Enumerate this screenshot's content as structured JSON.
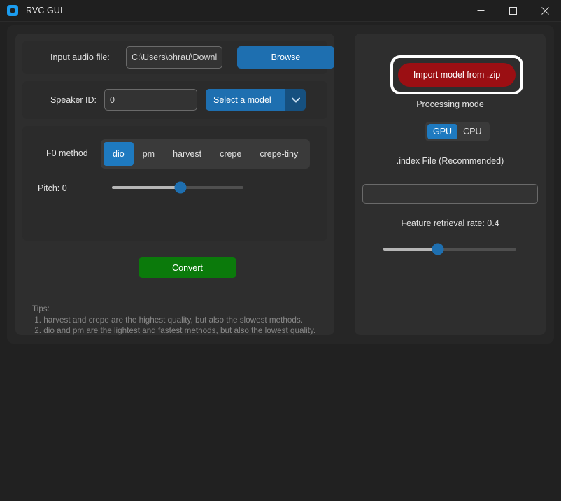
{
  "window": {
    "title": "RVC GUI",
    "icon": "app-logo-icon",
    "controls": {
      "minimize": "minimize-icon",
      "maximize": "maximize-icon",
      "close": "close-icon"
    }
  },
  "left_panel": {
    "input_audio": {
      "label": "Input audio file:",
      "value": "C:\\Users\\ohrau\\Downl",
      "placeholder": "",
      "browse_label": "Browse"
    },
    "speaker": {
      "label": "Speaker ID:",
      "value": "0",
      "placeholder": "",
      "model_select_label": "Select a model",
      "model_select_arrow": "chevron-down-icon"
    },
    "f0": {
      "label": "F0 method",
      "options": [
        "dio",
        "pm",
        "harvest",
        "crepe",
        "crepe-tiny"
      ],
      "selected": "dio"
    },
    "pitch": {
      "label": "Pitch: 0",
      "value": 0,
      "min": -12,
      "max": 12,
      "fill_percent": 52
    },
    "convert_label": "Convert",
    "tips": "Tips:\n 1. harvest and crepe are the highest quality, but also the slowest methods.\n 2. dio and pm are the lightest and fastest methods, but also the lowest quality."
  },
  "right_panel": {
    "import_label": "Import model from .zip",
    "import_highlighted": true,
    "processing_mode": {
      "label": "Processing mode",
      "options": [
        "GPU",
        "CPU"
      ],
      "selected": "GPU"
    },
    "index_file": {
      "label": ".index File (Recommended)",
      "value": "",
      "placeholder": ""
    },
    "retrieval": {
      "label": "Feature retrieval rate: 0.4",
      "value": 0.4,
      "min": 0,
      "max": 1,
      "fill_percent": 41
    }
  },
  "colors": {
    "accent_blue": "#1e6fb0",
    "segment_blue": "#1e7ac0",
    "convert_green": "#0b7a0b",
    "import_red": "#9b0f13",
    "highlight_ring": "#ffffff",
    "window_bg": "#212121",
    "panel_bg": "#2e2e2e",
    "group_bg": "#2b2b2b"
  }
}
